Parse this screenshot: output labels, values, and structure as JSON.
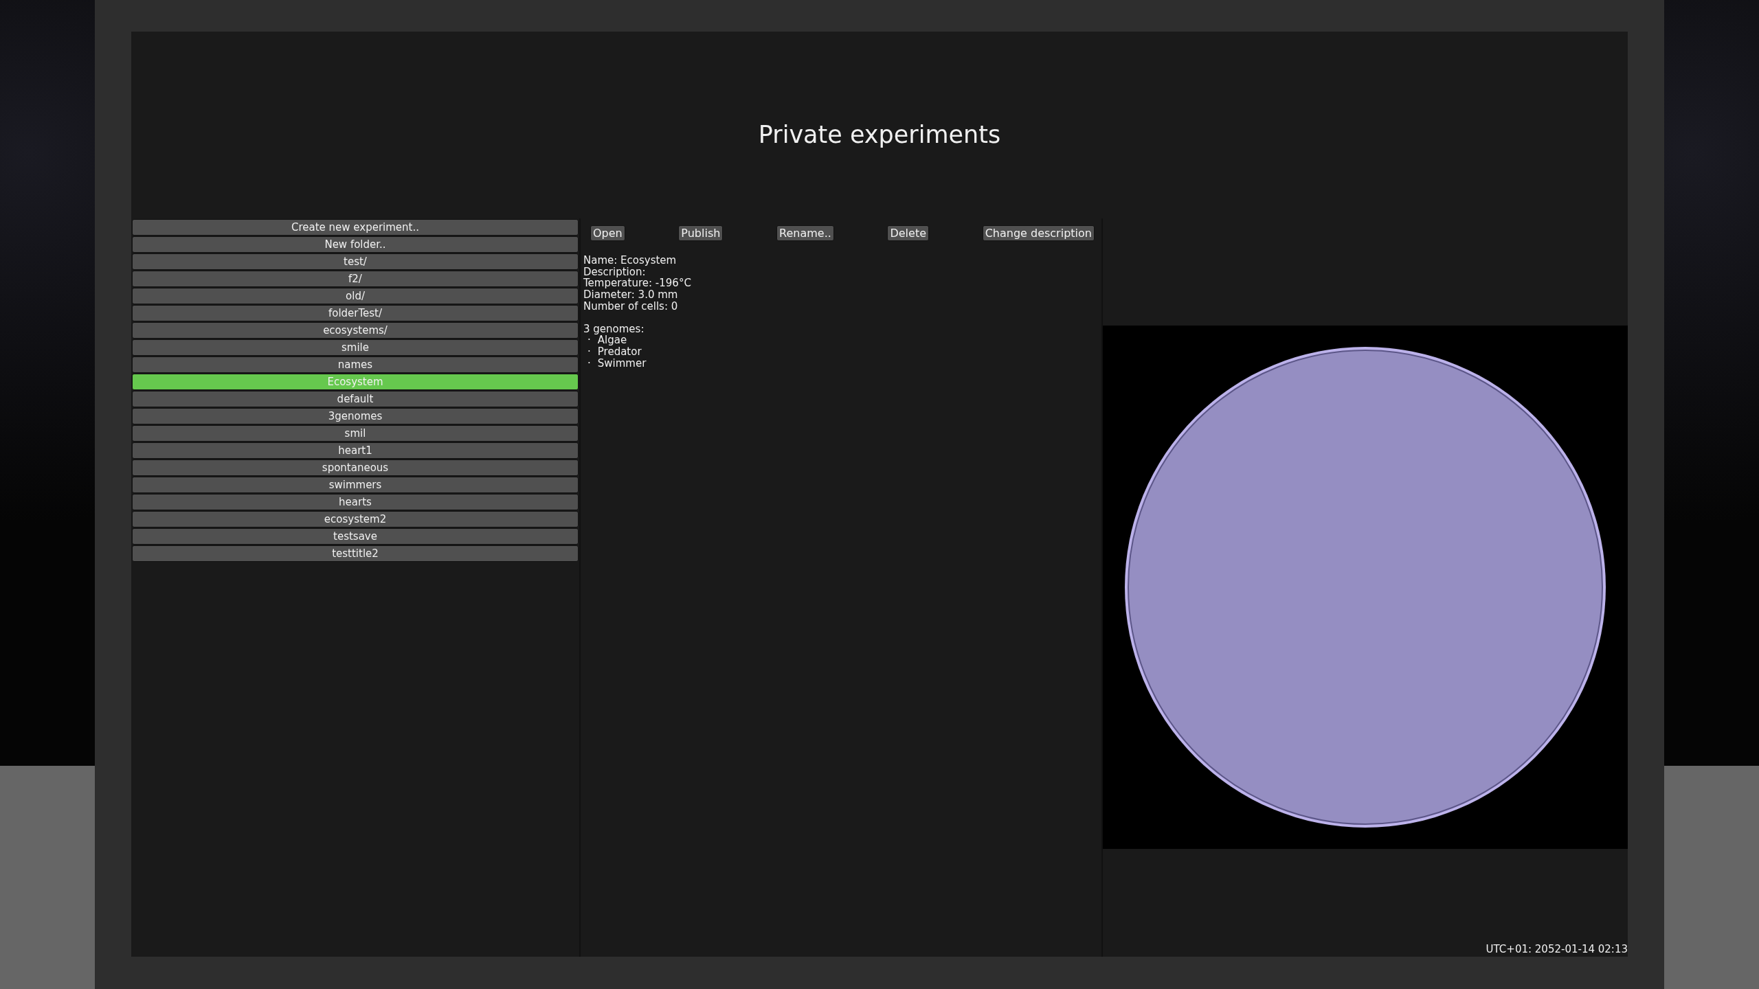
{
  "window": {
    "title": "Private experiments"
  },
  "experiments": [
    {
      "label": "Create new experiment..",
      "selected": false
    },
    {
      "label": "New folder..",
      "selected": false
    },
    {
      "label": "test/",
      "selected": false
    },
    {
      "label": "f2/",
      "selected": false
    },
    {
      "label": "old/",
      "selected": false
    },
    {
      "label": "folderTest/",
      "selected": false
    },
    {
      "label": "ecosystems/",
      "selected": false
    },
    {
      "label": "smile",
      "selected": false
    },
    {
      "label": "names",
      "selected": false
    },
    {
      "label": "Ecosystem",
      "selected": true
    },
    {
      "label": "default",
      "selected": false
    },
    {
      "label": "3genomes",
      "selected": false
    },
    {
      "label": "smil",
      "selected": false
    },
    {
      "label": "heart1",
      "selected": false
    },
    {
      "label": "spontaneous",
      "selected": false
    },
    {
      "label": "swimmers",
      "selected": false
    },
    {
      "label": "hearts",
      "selected": false
    },
    {
      "label": "ecosystem2",
      "selected": false
    },
    {
      "label": "testsave",
      "selected": false
    },
    {
      "label": "testtitle2",
      "selected": false
    }
  ],
  "actions": [
    "Open",
    "Publish",
    "Rename..",
    "Delete",
    "Change description"
  ],
  "details": [
    "Name: Ecosystem",
    "Description:",
    "Temperature: -196°C",
    "Diameter: 3.0 mm",
    "Number of cells: 0"
  ],
  "genomes": {
    "heading": "3 genomes:",
    "bullet": "·",
    "items": [
      "Algae",
      "Predator",
      "Swimmer"
    ]
  },
  "status_bar": {
    "clock": "UTC+01: 2052-01-14 02:13"
  }
}
